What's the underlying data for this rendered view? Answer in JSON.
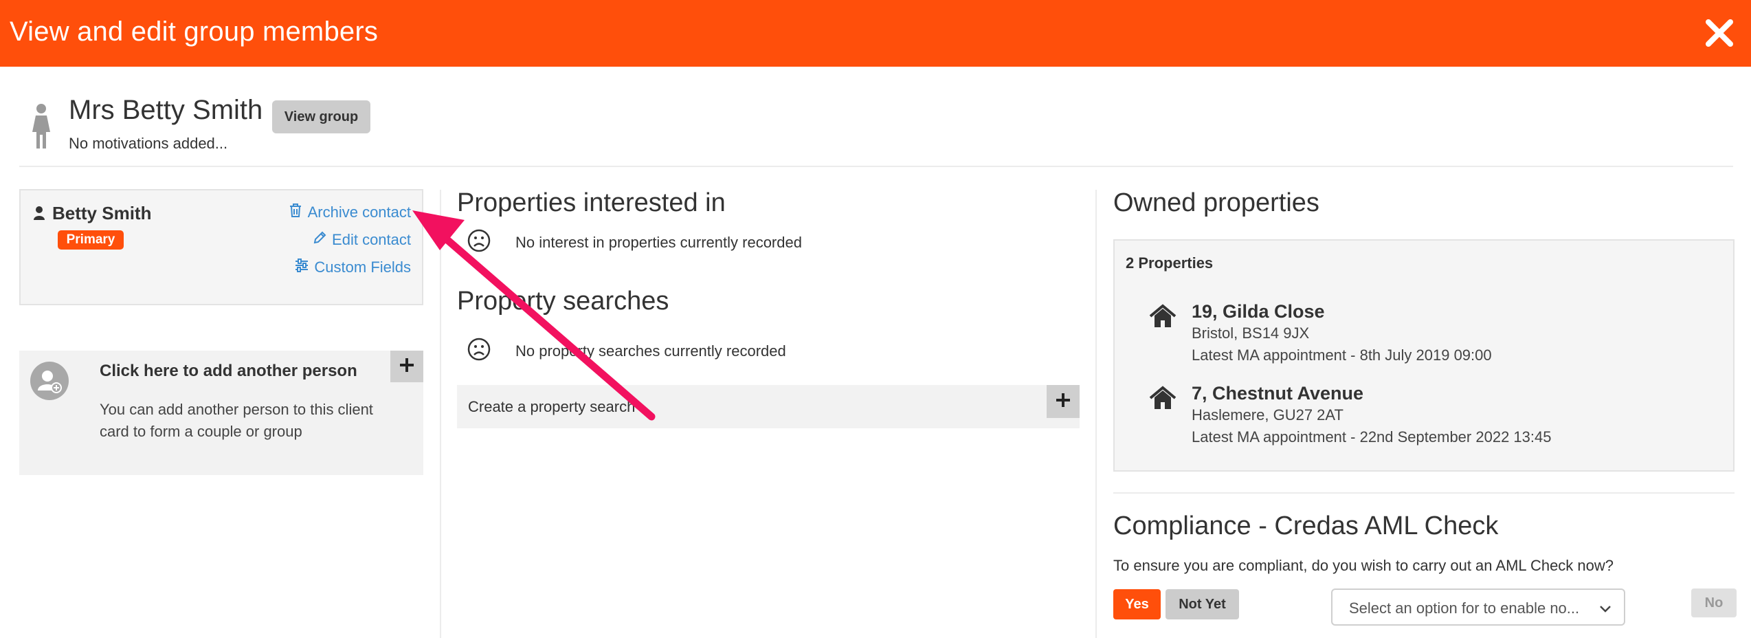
{
  "header": {
    "title": "View and edit group members"
  },
  "contact": {
    "name": "Mrs Betty Smith",
    "view_group_label": "View group",
    "motivations": "No motivations added..."
  },
  "member_card": {
    "name": "Betty Smith",
    "badge": "Primary",
    "archive_label": "Archive contact",
    "edit_label": "Edit contact",
    "custom_fields_label": "Custom Fields"
  },
  "add_person": {
    "title": "Click here to add another person",
    "description": "You can add another person to this client card to form a couple or group"
  },
  "properties_interested": {
    "title": "Properties interested in",
    "empty": "No interest in properties currently recorded"
  },
  "property_searches": {
    "title": "Property searches",
    "empty": "No property searches currently recorded",
    "create_label": "Create a property search"
  },
  "owned_properties": {
    "title": "Owned properties",
    "count_label": "2 Properties",
    "items": [
      {
        "address": "19, Gilda Close",
        "town": "Bristol, BS14 9JX",
        "appointment": "Latest MA appointment - 8th July 2019 09:00"
      },
      {
        "address": "7, Chestnut Avenue",
        "town": "Haslemere, GU27 2AT",
        "appointment": "Latest MA appointment - 22nd September 2022 13:45"
      }
    ]
  },
  "compliance": {
    "title": "Compliance - Credas AML Check",
    "question": "To ensure you are compliant, do you wish to carry out an AML Check now?",
    "yes_label": "Yes",
    "not_yet_label": "Not Yet",
    "select_placeholder": "Select an option for to enable no...",
    "no_label": "No"
  },
  "colors": {
    "accent": "#ff4f0b",
    "link": "#3a8bd0",
    "annotation_arrow": "#f2115f"
  }
}
